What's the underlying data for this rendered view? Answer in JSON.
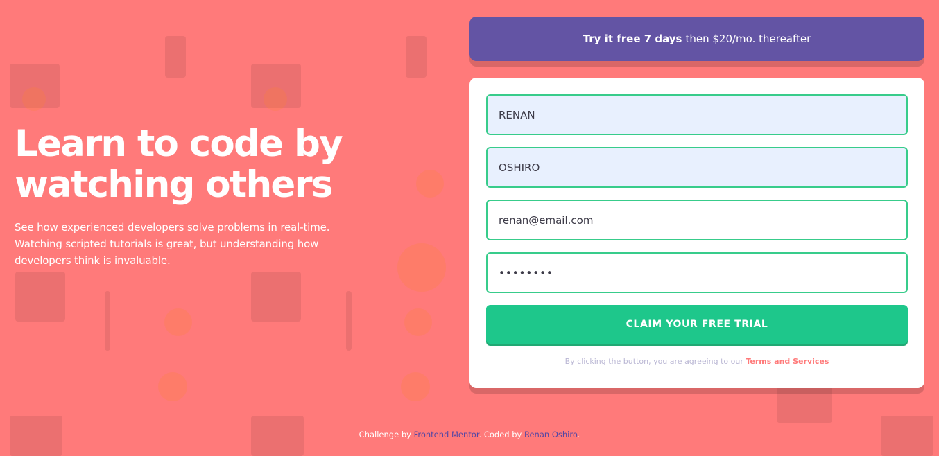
{
  "intro": {
    "heading_line1": "Learn to code by",
    "heading_line2": "watching others",
    "description": "See how experienced developers solve problems in real-time. Watching scripted tutorials is great, but understanding how developers think is invaluable."
  },
  "offer": {
    "bold_text": "Try it free 7 days",
    "rest_text": "then $20/mo. thereafter"
  },
  "form": {
    "first_name": {
      "value": "RENAN"
    },
    "last_name": {
      "value": "OSHIRO"
    },
    "email": {
      "value": "renan@email.com"
    },
    "password": {
      "value": "••••••••"
    },
    "submit_label": "CLAIM YOUR FREE TRIAL",
    "terms_prefix": "By clicking the button, you are agreeing to our",
    "terms_link": "Terms and Services"
  },
  "footer": {
    "challenge_prefix": "Challenge by",
    "challenge_link": "Frontend Mentor",
    "coded_prefix": "Coded by",
    "coded_link": "Renan Oshiro",
    "period": "."
  },
  "colors": {
    "background": "#ff7a7a",
    "offer_bg": "#6354a4",
    "accent_green": "#38cc8b",
    "button_green": "#1ec78b",
    "link_purple": "#5346a4"
  }
}
